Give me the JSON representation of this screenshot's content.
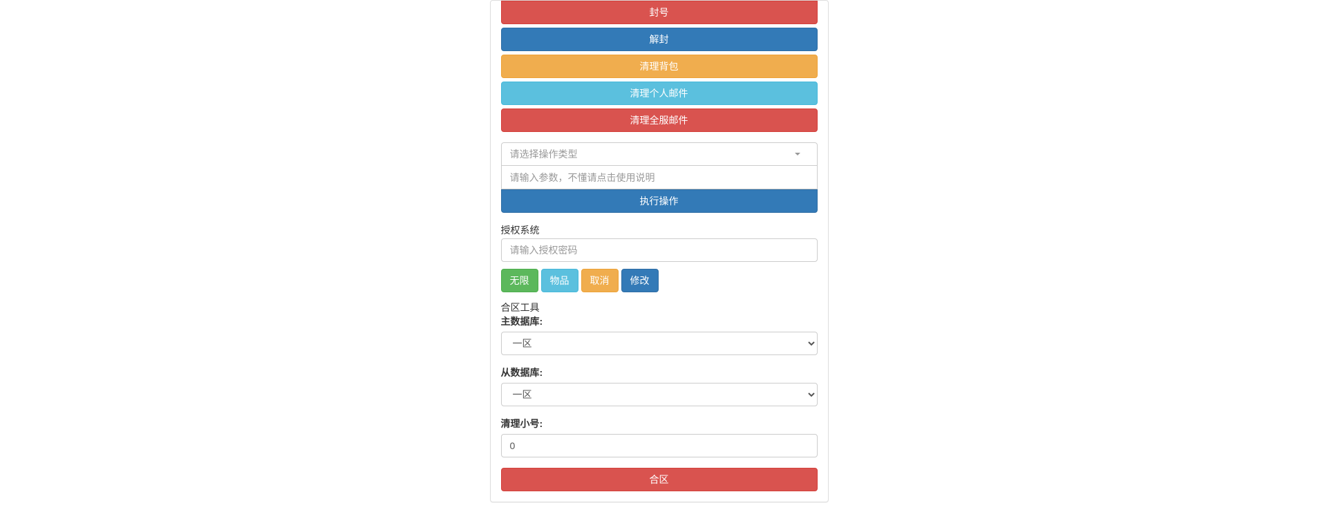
{
  "actions": {
    "ban": "封号",
    "unban": "解封",
    "clear_bag": "清理背包",
    "clear_personal_mail": "清理个人邮件",
    "clear_server_mail": "清理全服邮件"
  },
  "operation": {
    "type_placeholder": "请选择操作类型",
    "param_placeholder": "请输入参数，不懂请点击使用说明",
    "execute": "执行操作"
  },
  "auth": {
    "label": "授权系统",
    "password_placeholder": "请输入授权密码",
    "unlimited": "无限",
    "item": "物品",
    "cancel": "取消",
    "modify": "修改"
  },
  "merge": {
    "title": "合区工具",
    "main_db_label": "主数据库:",
    "slave_db_label": "从数据库:",
    "clear_alt_label": "清理小号:",
    "option_zone1": "一区",
    "clear_alt_value": "0",
    "merge_btn": "合区"
  }
}
